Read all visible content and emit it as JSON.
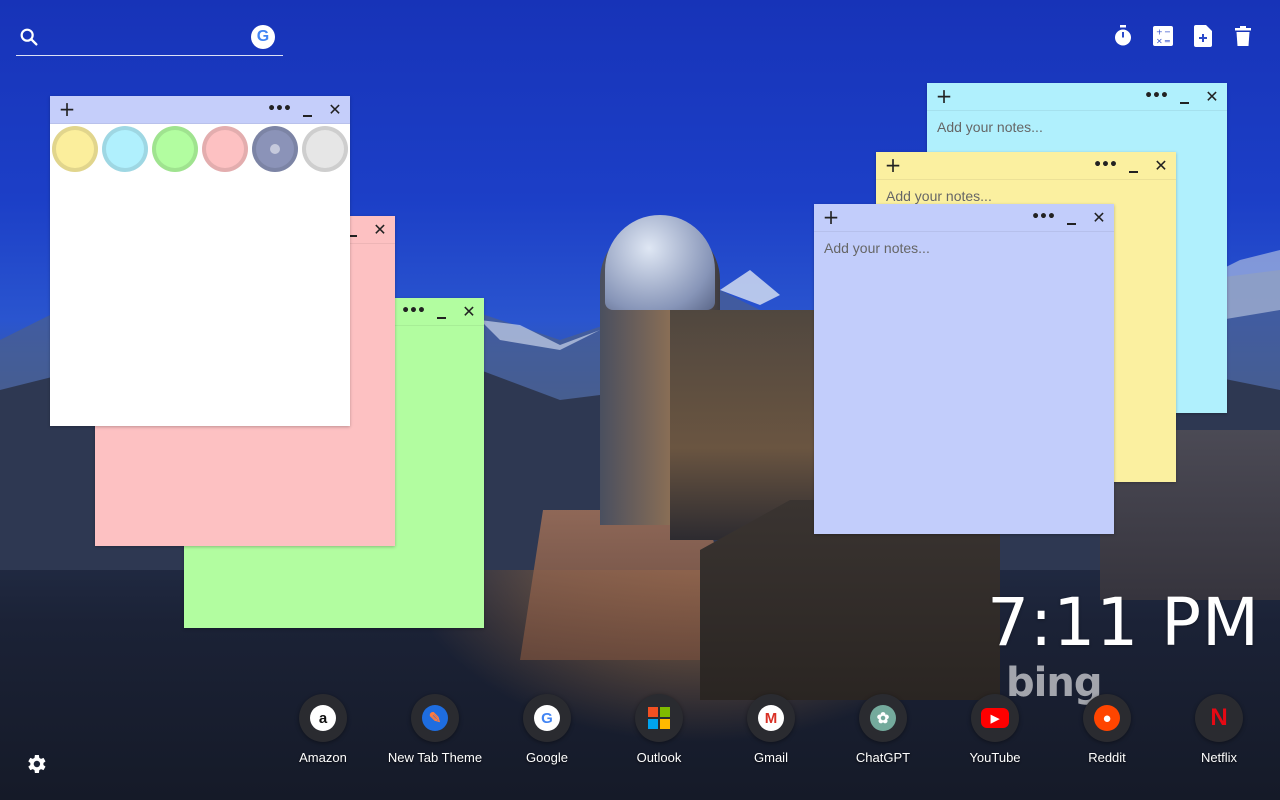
{
  "search": {
    "value": "",
    "engine_icon": "google-logo-icon",
    "engine_letter": "G"
  },
  "toolbar": {
    "icons": [
      "timer-icon",
      "calculator-icon",
      "new-note-icon",
      "trash-icon"
    ]
  },
  "notes": {
    "add_symbol": "+",
    "more_symbol": "•••",
    "close_symbol": "✕",
    "placeholder": "Add your notes...",
    "palette": {
      "colors": [
        "#fbee9c",
        "#b0f0fd",
        "#b2fda0",
        "#fdc1c2",
        "#8b93b8",
        "#e6e6e6"
      ],
      "selected_index": 4
    },
    "items": [
      {
        "id": "white",
        "color": "#ffffff",
        "value": ""
      },
      {
        "id": "pink",
        "color": "#fdc1c2",
        "value": ""
      },
      {
        "id": "green",
        "color": "#b2fda0",
        "value": ""
      },
      {
        "id": "cyan",
        "color": "#b0f0fd",
        "value": ""
      },
      {
        "id": "yellow",
        "color": "#fbf0a0",
        "value": ""
      },
      {
        "id": "blue",
        "color": "#c2cdfb",
        "value": ""
      }
    ]
  },
  "clock": {
    "time": "7:11 PM"
  },
  "branding": {
    "watermark": "bing"
  },
  "shortcuts": [
    {
      "label": "Amazon",
      "icon": "amazon-icon",
      "glyph": "a",
      "bg": "#ffffff",
      "fg": "#111111"
    },
    {
      "label": "New Tab Theme",
      "icon": "new-tab-theme-icon",
      "glyph": "✎",
      "bg": "#1e6de0",
      "fg": "#ff7a3c"
    },
    {
      "label": "Google",
      "icon": "google-icon",
      "glyph": "G",
      "bg": "#ffffff",
      "fg": "#4285f4"
    },
    {
      "label": "Outlook",
      "icon": "outlook-icon",
      "glyph": "",
      "bg": "transparent",
      "fg": "#ffffff"
    },
    {
      "label": "Gmail",
      "icon": "gmail-icon",
      "glyph": "M",
      "bg": "#ffffff",
      "fg": "#d93025"
    },
    {
      "label": "ChatGPT",
      "icon": "chatgpt-icon",
      "glyph": "✿",
      "bg": "#74aa9c",
      "fg": "#ffffff"
    },
    {
      "label": "YouTube",
      "icon": "youtube-icon",
      "glyph": "▶",
      "bg": "#ff0000",
      "fg": "#ffffff"
    },
    {
      "label": "Reddit",
      "icon": "reddit-icon",
      "glyph": "●",
      "bg": "#ff4500",
      "fg": "#ffffff"
    },
    {
      "label": "Netflix",
      "icon": "netflix-icon",
      "glyph": "N",
      "bg": "transparent",
      "fg": "#e50914"
    }
  ],
  "settings": {
    "icon": "gear-icon"
  }
}
